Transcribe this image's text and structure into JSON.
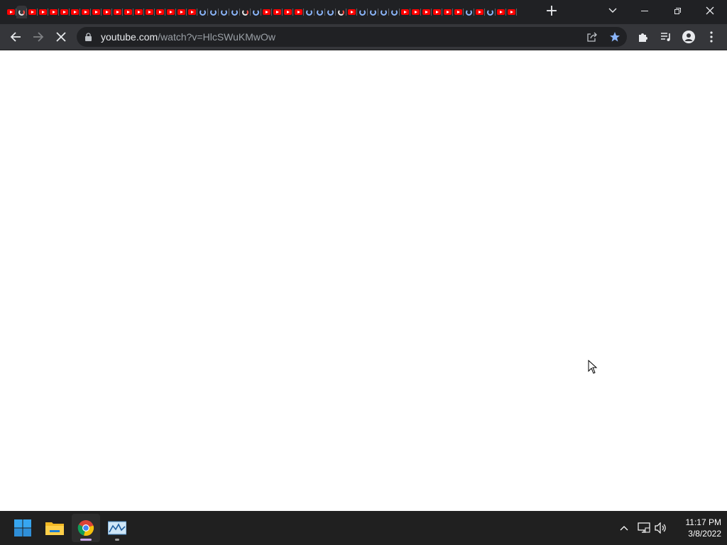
{
  "browser": {
    "tab_favicons": [
      "yt",
      "yt-spin",
      "yt",
      "yt",
      "yt",
      "yt",
      "yt",
      "yt",
      "yt",
      "yt",
      "yt",
      "yt",
      "yt",
      "yt",
      "yt",
      "yt",
      "yt",
      "yt",
      "spin",
      "spin",
      "spin",
      "spin",
      "yt-spin",
      "spin",
      "yt",
      "yt",
      "yt",
      "yt",
      "spin",
      "spin",
      "spin",
      "yt-spin",
      "yt",
      "spin",
      "spin",
      "spin",
      "spin",
      "yt",
      "yt",
      "yt",
      "yt",
      "yt",
      "yt",
      "spin",
      "yt",
      "spin",
      "yt",
      "yt",
      "yt",
      "yt"
    ],
    "new_tab_label": "+",
    "window_controls": {
      "tab_search_icon": "chevron-down-icon",
      "minimize_icon": "minimize-icon",
      "restore_icon": "restore-icon",
      "close_icon": "close-icon"
    },
    "toolbar": {
      "back_icon": "arrow-left-icon",
      "forward_icon": "arrow-right-icon",
      "stop_icon": "stop-icon",
      "url_host": "youtube.com",
      "url_path": "/watch?v=HlcSWuKMwOw",
      "share_icon": "share-icon",
      "bookmark_icon": "star-icon",
      "extensions_icon": "puzzle-icon",
      "media_icon": "media-queue-icon",
      "profile_icon": "profile-icon",
      "menu_icon": "kebab-menu-icon"
    },
    "colors": {
      "tabstrip_bg": "#202124",
      "toolbar_bg": "#35363a",
      "omnibox_bg": "#202124",
      "bookmark_star": "#8ab4f8",
      "youtube_red": "#ff0000"
    }
  },
  "taskbar": {
    "apps": [
      "windows-start-icon",
      "file-explorer-icon",
      "chrome-icon",
      "resource-monitor-icon"
    ],
    "tray": {
      "overflow_icon": "chevron-up-icon",
      "network_icon": "network-icon",
      "volume_icon": "volume-icon",
      "time": "11:17 PM",
      "date": "3/8/2022"
    }
  }
}
